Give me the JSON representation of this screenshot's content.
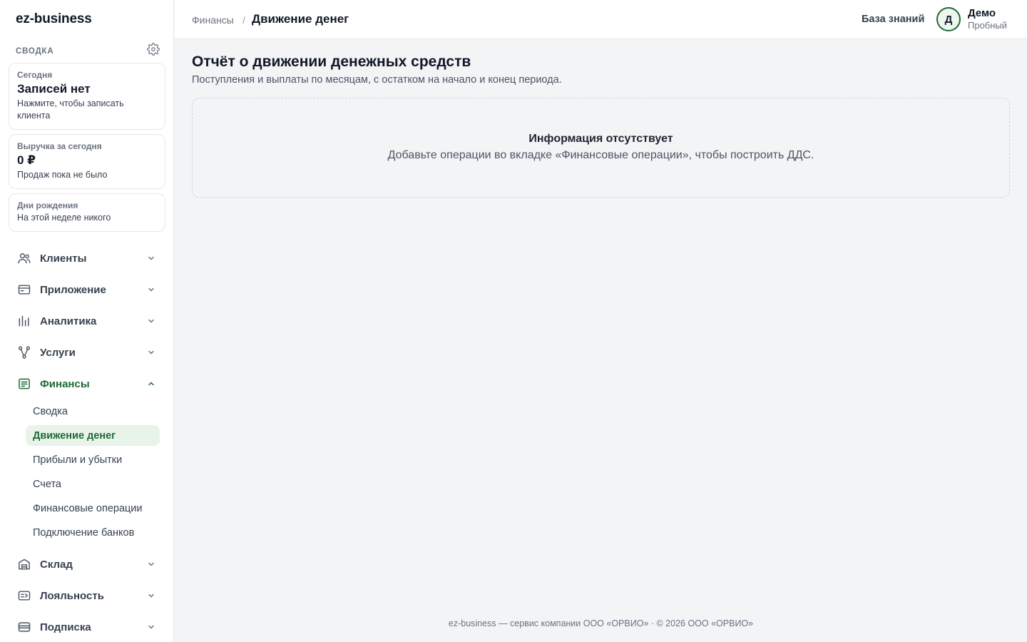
{
  "app": {
    "logo": "ez-business"
  },
  "sidebar": {
    "summary_title": "СВОДКА",
    "cards": [
      {
        "label": "Сегодня",
        "value": "Записей нет",
        "note": "Нажмите, чтобы записать клиента"
      },
      {
        "label": "Выручка за сегодня",
        "value": "0 ₽",
        "note": "Продаж пока не было"
      },
      {
        "label": "Дни рождения",
        "note": "На этой неделе никого"
      }
    ],
    "nav": [
      {
        "label": "Клиенты",
        "icon": "users-icon",
        "expanded": false
      },
      {
        "label": "Приложение",
        "icon": "card-icon",
        "expanded": false
      },
      {
        "label": "Аналитика",
        "icon": "bar-chart-icon",
        "expanded": false
      },
      {
        "label": "Услуги",
        "icon": "branch-icon",
        "expanded": false
      },
      {
        "label": "Финансы",
        "icon": "finance-icon",
        "expanded": true,
        "active": true
      },
      {
        "label": "Склад",
        "icon": "warehouse-icon",
        "expanded": false
      },
      {
        "label": "Лояльность",
        "icon": "loyalty-icon",
        "expanded": false
      },
      {
        "label": "Подписка",
        "icon": "subscription-icon",
        "expanded": false
      }
    ],
    "finance_sub": [
      "Сводка",
      "Движение денег",
      "Прибыли и убытки",
      "Счета",
      "Финансовые операции",
      "Подключение банков"
    ],
    "finance_active": "Движение денег"
  },
  "topbar": {
    "breadcrumb_parent": "Финансы",
    "breadcrumb_sep": "/",
    "breadcrumb_current": "Движение денег",
    "kb_link": "База знаний",
    "avatar_letter": "Д",
    "user_name": "Демо",
    "user_plan": "Пробный"
  },
  "main": {
    "title": "Отчёт о движении денежных средств",
    "subtitle": "Поступления и выплаты по месяцам, с остатком на начало и конец периода.",
    "empty_title": "Информация отсутствует",
    "empty_text": "Добавьте операции во вкладке «Финансовые операции», чтобы построить ДДС."
  },
  "footer": {
    "text": "ez-business — сервис компании ООО «ОРВИО» · © 2026 ООО «ОРВИО»"
  },
  "colors": {
    "accent": "#1e6b34",
    "accent_bg": "#e8f4ea",
    "page_bg": "#f3f4f6"
  }
}
